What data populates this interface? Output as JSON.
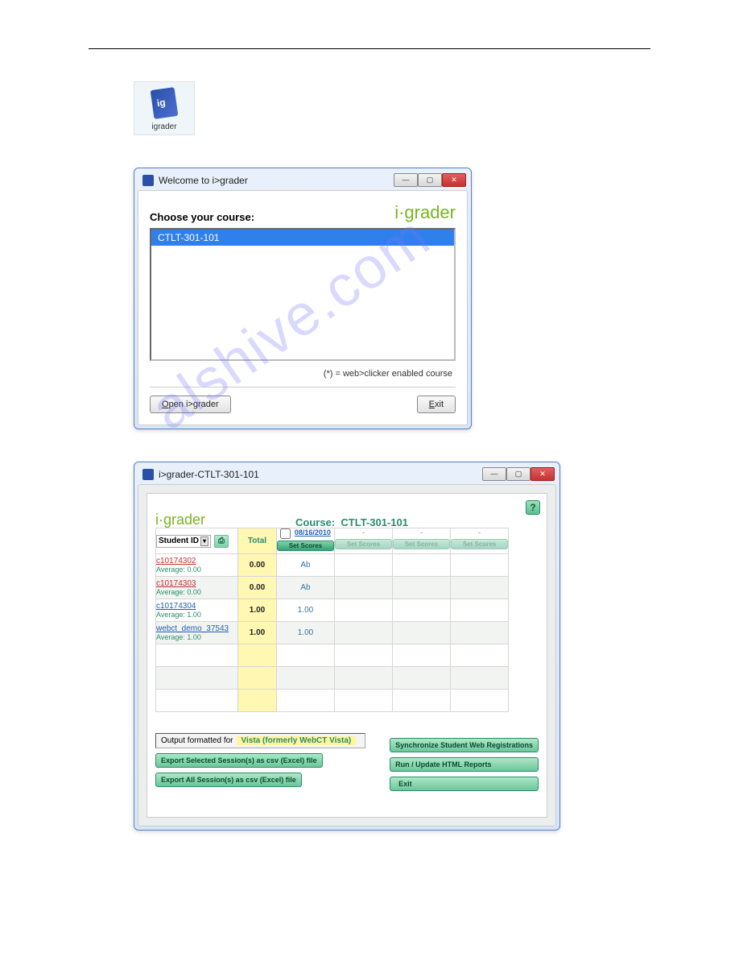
{
  "watermark": "alshive.com",
  "desktopIcon": {
    "label": "igrader"
  },
  "welcome": {
    "title": "Welcome to i>grader",
    "chooseLabel": "Choose your course:",
    "logo": "i·grader",
    "courses": [
      "CTLT-301-101"
    ],
    "note": "(*) = web>clicker enabled course",
    "openBtn": {
      "pre": "O",
      "rest": "pen i>grader"
    },
    "exitBtn": {
      "pre": "E",
      "rest": "xit"
    }
  },
  "main": {
    "title": "i>grader-CTLT-301-101",
    "logo": "i·grader",
    "courseLabel": "Course:",
    "courseName": "CTLT-301-101",
    "help": "?",
    "sidLabel": "Student ID",
    "totalHeader": "Total",
    "sessions": [
      {
        "date": "08/16/2010",
        "btn": "Set Scores",
        "active": true
      },
      {
        "date": "-",
        "btn": "Set Scores",
        "active": false
      },
      {
        "date": "-",
        "btn": "Set Scores",
        "active": false
      },
      {
        "date": "-",
        "btn": "Set Scores",
        "active": false
      }
    ],
    "rows": [
      {
        "sid": "c10174302",
        "color": "red",
        "avg": "Average: 0.00",
        "total": "0.00",
        "s1": "Ab"
      },
      {
        "sid": "c10174303",
        "color": "red",
        "avg": "Average: 0.00",
        "total": "0.00",
        "s1": "Ab"
      },
      {
        "sid": "c10174304",
        "color": "blue",
        "avg": "Average: 1.00",
        "total": "1.00",
        "s1": "1.00"
      },
      {
        "sid": "webct_demo_37543",
        "color": "blue",
        "avg": "Average: 1.00",
        "total": "1.00",
        "s1": "1.00"
      }
    ],
    "outputLabel": "Output formatted for",
    "outputValue": "Vista (formerly WebCT Vista)",
    "btnExportSel": "Export Selected Session(s) as csv (Excel) file",
    "btnExportAll": "Export All Session(s) as csv (Excel) file",
    "btnSync": "Synchronize Student Web Registrations",
    "btnReports": "Run / Update HTML Reports",
    "btnExit": "Exit"
  }
}
